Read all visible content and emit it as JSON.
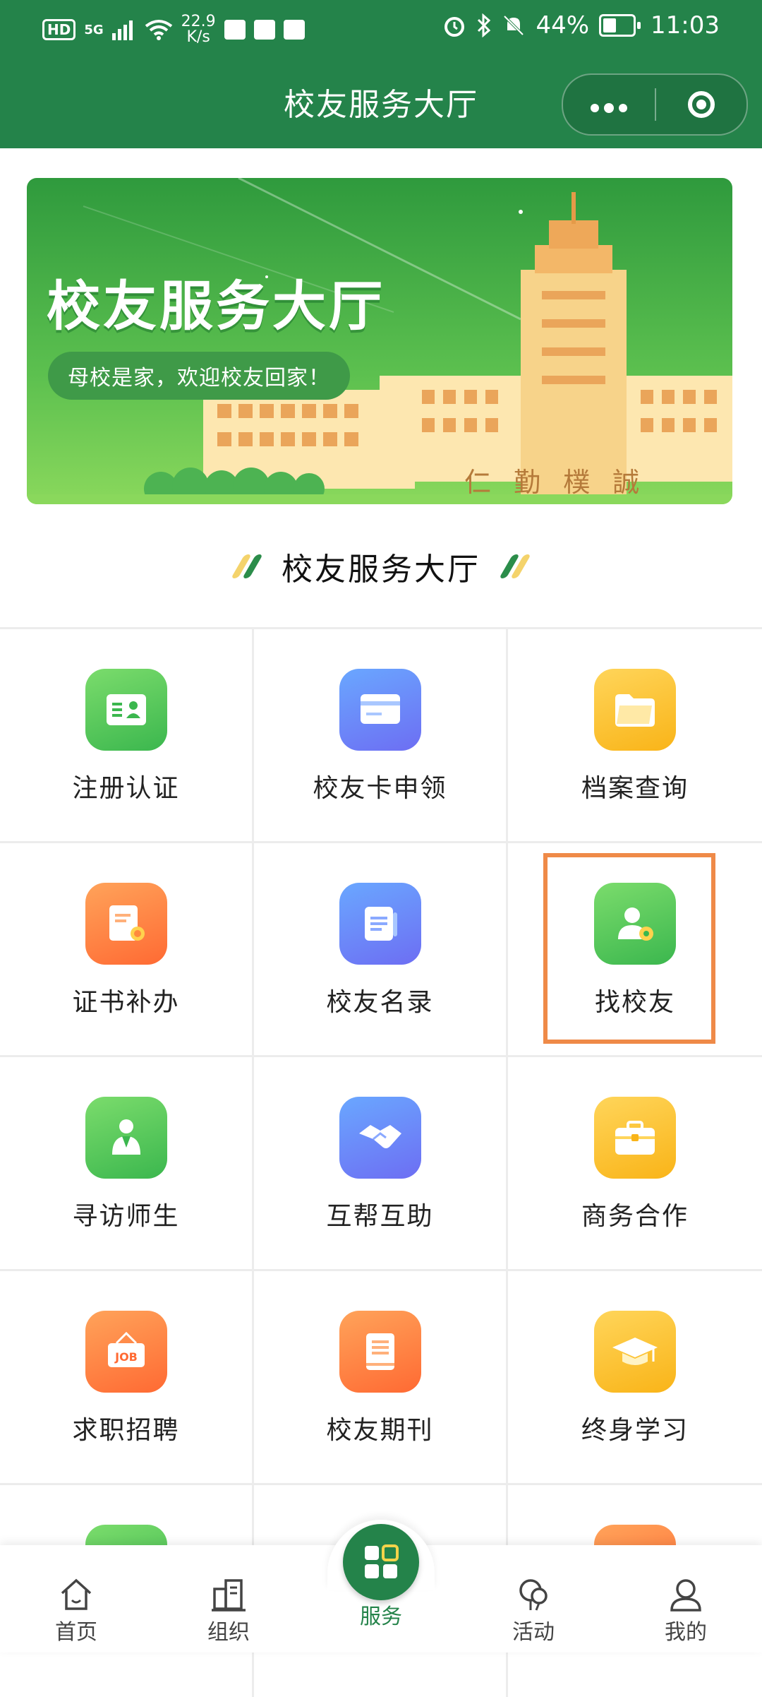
{
  "status_bar": {
    "network": "HD",
    "signal": "5G",
    "speed_value": "22.9",
    "speed_unit": "K/s",
    "battery": "44%",
    "time": "11:03"
  },
  "header": {
    "title": "校友服务大厅",
    "more_icon": "more-dots-icon",
    "close_icon": "target-circle-icon"
  },
  "banner": {
    "title": "校友服务大厅",
    "subtitle": "母校是家，欢迎校友回家！",
    "motto": "仁 勤 樸 誠"
  },
  "section": {
    "title": "校友服务大厅"
  },
  "services": [
    {
      "label": "注册认证",
      "icon": "id-card-icon",
      "color": "green"
    },
    {
      "label": "校友卡申领",
      "icon": "card-icon",
      "color": "blue"
    },
    {
      "label": "档案查询",
      "icon": "folder-icon",
      "color": "yellow"
    },
    {
      "label": "证书补办",
      "icon": "certificate-icon",
      "color": "orange"
    },
    {
      "label": "校友名录",
      "icon": "directory-icon",
      "color": "blue"
    },
    {
      "label": "找校友",
      "icon": "find-person-icon",
      "color": "green"
    },
    {
      "label": "寻访师生",
      "icon": "teacher-icon",
      "color": "green"
    },
    {
      "label": "互帮互助",
      "icon": "handshake-icon",
      "color": "blue"
    },
    {
      "label": "商务合作",
      "icon": "briefcase-icon",
      "color": "yellow"
    },
    {
      "label": "求职招聘",
      "icon": "job-sign-icon",
      "color": "orange"
    },
    {
      "label": "校友期刊",
      "icon": "journal-icon",
      "color": "orange"
    },
    {
      "label": "终身学习",
      "icon": "graduation-cap-icon",
      "color": "yellow"
    }
  ],
  "tabbar": [
    {
      "label": "首页",
      "icon": "home-icon"
    },
    {
      "label": "组织",
      "icon": "building-icon"
    },
    {
      "label": "服务",
      "icon": "grid-icon",
      "active": true
    },
    {
      "label": "活动",
      "icon": "balloon-icon"
    },
    {
      "label": "我的",
      "icon": "person-icon"
    }
  ],
  "colors": {
    "primary": "#24834a",
    "highlight_border": "#ef8a48"
  }
}
